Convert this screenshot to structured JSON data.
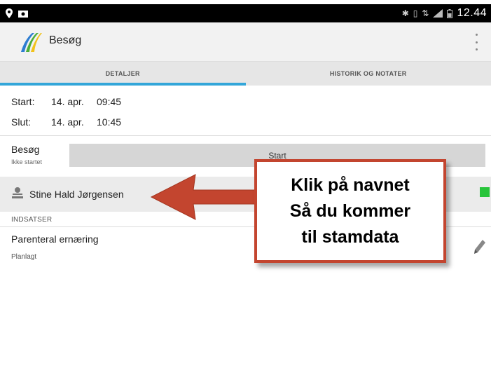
{
  "status_bar": {
    "icons_left": [
      "location-icon",
      "image-icon"
    ],
    "icons_right": [
      "bluetooth-icon",
      "vibrate-icon",
      "4g-icon",
      "signal-icon",
      "battery-icon"
    ],
    "time": "12.44"
  },
  "app_bar": {
    "title": "Besøg",
    "logo_colors": [
      "#2e7dd1",
      "#4cae3a",
      "#f1c21b"
    ]
  },
  "tabs": [
    {
      "label": "DETALJER",
      "active": true
    },
    {
      "label": "HISTORIK OG NOTATER",
      "active": false
    }
  ],
  "details": {
    "start": {
      "label": "Start:",
      "date": "14. apr.",
      "time": "09:45"
    },
    "end": {
      "label": "Slut:",
      "date": "14. apr.",
      "time": "10:45"
    }
  },
  "visit": {
    "title": "Besøg",
    "status": "Ikke startet",
    "start_button": "Start"
  },
  "patient": {
    "name": "Stine Hald Jørgensen",
    "status_color": "#27c43a"
  },
  "interventions": {
    "header": "INDSATSER",
    "items": [
      {
        "title": "Parenteral ernæring",
        "status": "Planlagt"
      }
    ]
  },
  "annotation": {
    "lines": [
      "Klik på navnet",
      "Så du kommer",
      "til stamdata"
    ],
    "border_color": "#c3452f"
  },
  "colors": {
    "accent": "#33a6d9"
  }
}
